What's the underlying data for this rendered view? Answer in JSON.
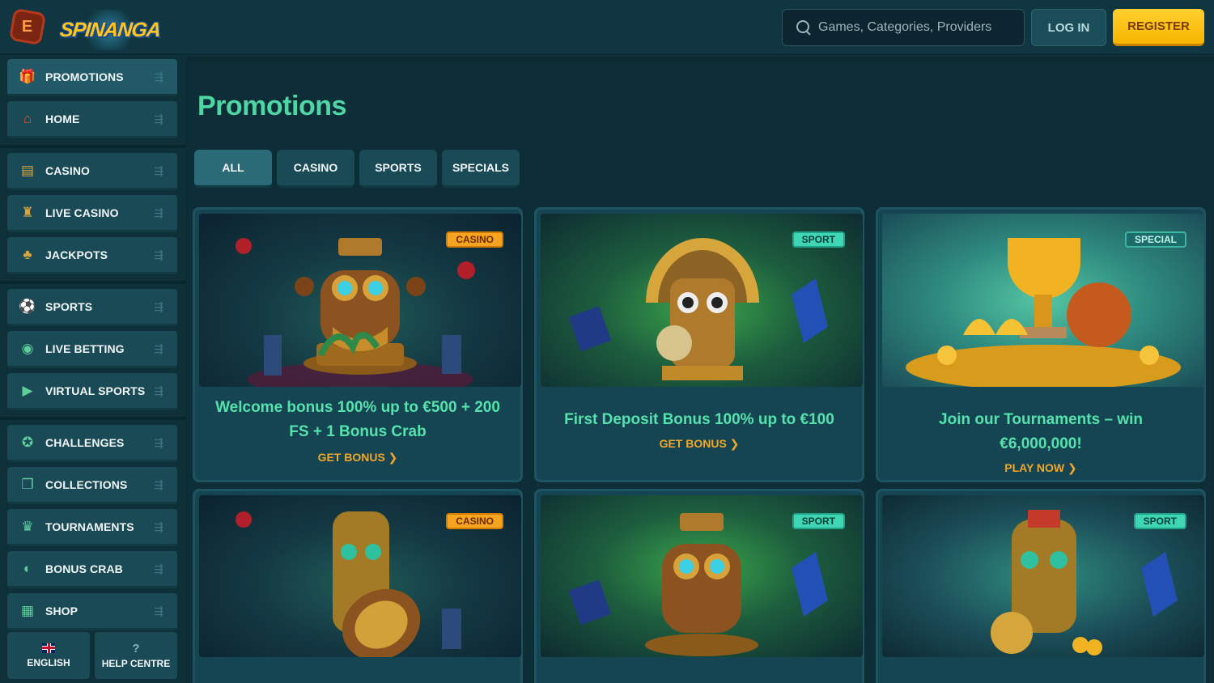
{
  "header": {
    "menu_badge_glyph": "E",
    "logo_text": "SPINANGA",
    "search_placeholder": "Games, Categories, Providers",
    "login_label": "LOG IN",
    "register_label": "REGISTER"
  },
  "sidebar": {
    "items": [
      {
        "label": "PROMOTIONS",
        "icon": "gift-icon",
        "glyph": "🎁"
      },
      {
        "label": "HOME",
        "icon": "home-icon",
        "glyph": "⌂"
      },
      {
        "label": "CASINO",
        "icon": "casino-icon",
        "glyph": "▤"
      },
      {
        "label": "LIVE CASINO",
        "icon": "dealer-icon",
        "glyph": "♜"
      },
      {
        "label": "JACKPOTS",
        "icon": "clover-icon",
        "glyph": "♣"
      },
      {
        "label": "SPORTS",
        "icon": "soccer-ball-icon",
        "glyph": "⚽"
      },
      {
        "label": "LIVE BETTING",
        "icon": "live-icon",
        "glyph": "◉"
      },
      {
        "label": "VIRTUAL SPORTS",
        "icon": "play-icon",
        "glyph": "▶"
      },
      {
        "label": "CHALLENGES",
        "icon": "medal-icon",
        "glyph": "✪"
      },
      {
        "label": "COLLECTIONS",
        "icon": "cards-icon",
        "glyph": "❐"
      },
      {
        "label": "TOURNAMENTS",
        "icon": "trophy-icon",
        "glyph": "♛"
      },
      {
        "label": "BONUS CRAB",
        "icon": "crab-icon",
        "glyph": "◐"
      },
      {
        "label": "SHOP",
        "icon": "shop-icon",
        "glyph": "▦"
      }
    ],
    "language_label": "ENGLISH",
    "help_label": "HELP CENTRE",
    "help_glyph": "?"
  },
  "main": {
    "title": "Promotions",
    "tabs": [
      "ALL",
      "CASINO",
      "SPORTS",
      "SPECIALS"
    ],
    "cards": [
      {
        "badge": "CASINO",
        "title": "Welcome bonus 100% up to €500 + 200 FS + 1 Bonus Crab",
        "cta": "GET BONUS ❯"
      },
      {
        "badge": "SPORT",
        "title": "First Deposit Bonus 100% up to €100",
        "cta": "GET BONUS ❯"
      },
      {
        "badge": "SPECIAL",
        "title": "Join our Tournaments – win €6,000,000!",
        "cta": "PLAY NOW ❯"
      },
      {
        "badge": "CASINO",
        "title": "",
        "cta": ""
      },
      {
        "badge": "SPORT",
        "title": "",
        "cta": ""
      },
      {
        "badge": "SPORT",
        "title": "",
        "cta": ""
      }
    ]
  },
  "colors": {
    "background": "#0d2e37",
    "accent_green": "#4fd6a4",
    "cta_orange": "#f0a72a",
    "register_yellow": "#ffc61c"
  }
}
